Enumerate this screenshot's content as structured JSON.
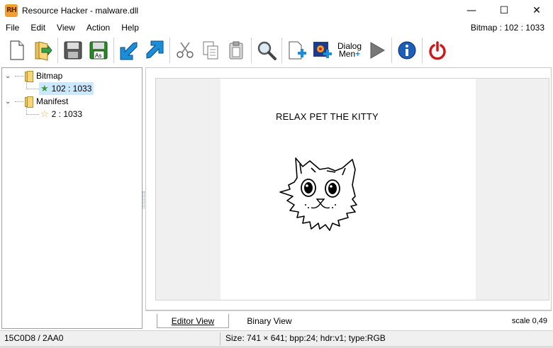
{
  "window": {
    "title": "Resource Hacker - malware.dll",
    "app_icon_text": "RH",
    "minimize_glyph": "—",
    "maximize_glyph": "☐",
    "close_glyph": "✕"
  },
  "menu": {
    "items": [
      "File",
      "Edit",
      "View",
      "Action",
      "Help"
    ],
    "status": "Bitmap : 102 : 1033"
  },
  "toolbar": {
    "buttons": [
      {
        "name": "new-file-icon"
      },
      {
        "name": "open-file-icon"
      },
      {
        "name": "save-icon"
      },
      {
        "name": "save-as-icon",
        "text": "As"
      },
      {
        "name": "arrow-down-left-icon"
      },
      {
        "name": "arrow-up-right-icon"
      },
      {
        "name": "cut-icon"
      },
      {
        "name": "copy-icon"
      },
      {
        "name": "paste-icon"
      },
      {
        "name": "find-icon"
      },
      {
        "name": "add-resource-icon"
      },
      {
        "name": "add-image-icon"
      },
      {
        "name": "dialog-menu-icon",
        "text": "Dialog Men"
      },
      {
        "name": "run-script-icon"
      },
      {
        "name": "info-icon"
      },
      {
        "name": "power-icon"
      }
    ],
    "dialog_line1": "Dialog",
    "dialog_line2": "Men"
  },
  "tree": {
    "groups": [
      {
        "label": "Bitmap",
        "children": [
          {
            "label": "102 : 1033",
            "selected": true
          }
        ]
      },
      {
        "label": "Manifest",
        "children": [
          {
            "label": "2 : 1033",
            "selected": false
          }
        ]
      }
    ]
  },
  "bitmap": {
    "caption": "RELAX PET THE KITTY"
  },
  "tabs": [
    {
      "label": "Editor View",
      "active": true
    },
    {
      "label": "Binary View",
      "active": false
    }
  ],
  "scale": "scale 0,49",
  "status": {
    "offset": "15C0D8 / 2AA0",
    "info": "Size: 741 × 641;  bpp:24;  hdr:v1;  type:RGB"
  },
  "colors": {
    "selection": "#cce8ff",
    "arrow_blue": "#1a8fd8",
    "save_green": "#2a8a2a",
    "info_blue": "#1c5fb8",
    "power_red": "#d01818"
  }
}
